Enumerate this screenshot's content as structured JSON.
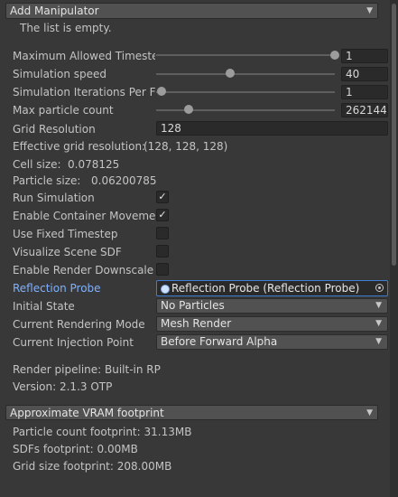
{
  "add_manipulator": {
    "label": "Add Manipulator"
  },
  "list_empty": "The list is empty.",
  "sliders": [
    {
      "label": "Maximum Allowed Timestep",
      "value": "1",
      "fraction": 1.0
    },
    {
      "label": "Simulation speed",
      "value": "40",
      "fraction": 0.4
    },
    {
      "label": "Simulation Iterations Per Frame",
      "value": "1",
      "fraction": 0.0
    },
    {
      "label": "Max particle count",
      "value": "262144",
      "fraction": 0.15
    }
  ],
  "grid_resolution": {
    "label": "Grid Resolution",
    "value": "128"
  },
  "effective_grid": {
    "label": "Effective grid resolution:",
    "value": "(128, 128, 128)"
  },
  "cell_size": {
    "label": "Cell size:",
    "value": "0.078125"
  },
  "particle_size": {
    "label": "Particle size:",
    "value": "0.06200785"
  },
  "toggles": [
    {
      "label": "Run Simulation",
      "checked": true,
      "mark": "✓"
    },
    {
      "label": "Enable Container Movement Stabilization",
      "checked": true,
      "mark": "✓"
    },
    {
      "label": "Use Fixed Timestep",
      "checked": false,
      "mark": ""
    },
    {
      "label": "Visualize Scene SDF",
      "checked": false,
      "mark": ""
    },
    {
      "label": "Enable Render Downscale",
      "checked": false,
      "mark": ""
    }
  ],
  "reflection_probe": {
    "label": "Reflection Probe",
    "value": "Reflection Probe (Reflection Probe)"
  },
  "initial_state": {
    "label": "Initial State",
    "value": "No Particles"
  },
  "rendering_mode": {
    "label": "Current Rendering Mode",
    "value": "Mesh Render"
  },
  "injection_point": {
    "label": "Current Injection Point",
    "value": "Before Forward Alpha"
  },
  "render_pipeline": "Render pipeline: Built-in RP",
  "version": "Version: 2.1.3 OTP",
  "vram": {
    "label": "Approximate VRAM footprint",
    "particle": "Particle count footprint: 31.13MB",
    "sdfs": "SDFs footprint: 0.00MB",
    "grid": "Grid size footprint: 208.00MB"
  },
  "colors": {
    "background": "#383838",
    "link_label": "#7fb1ff",
    "focus_border": "#3d7ed3"
  }
}
